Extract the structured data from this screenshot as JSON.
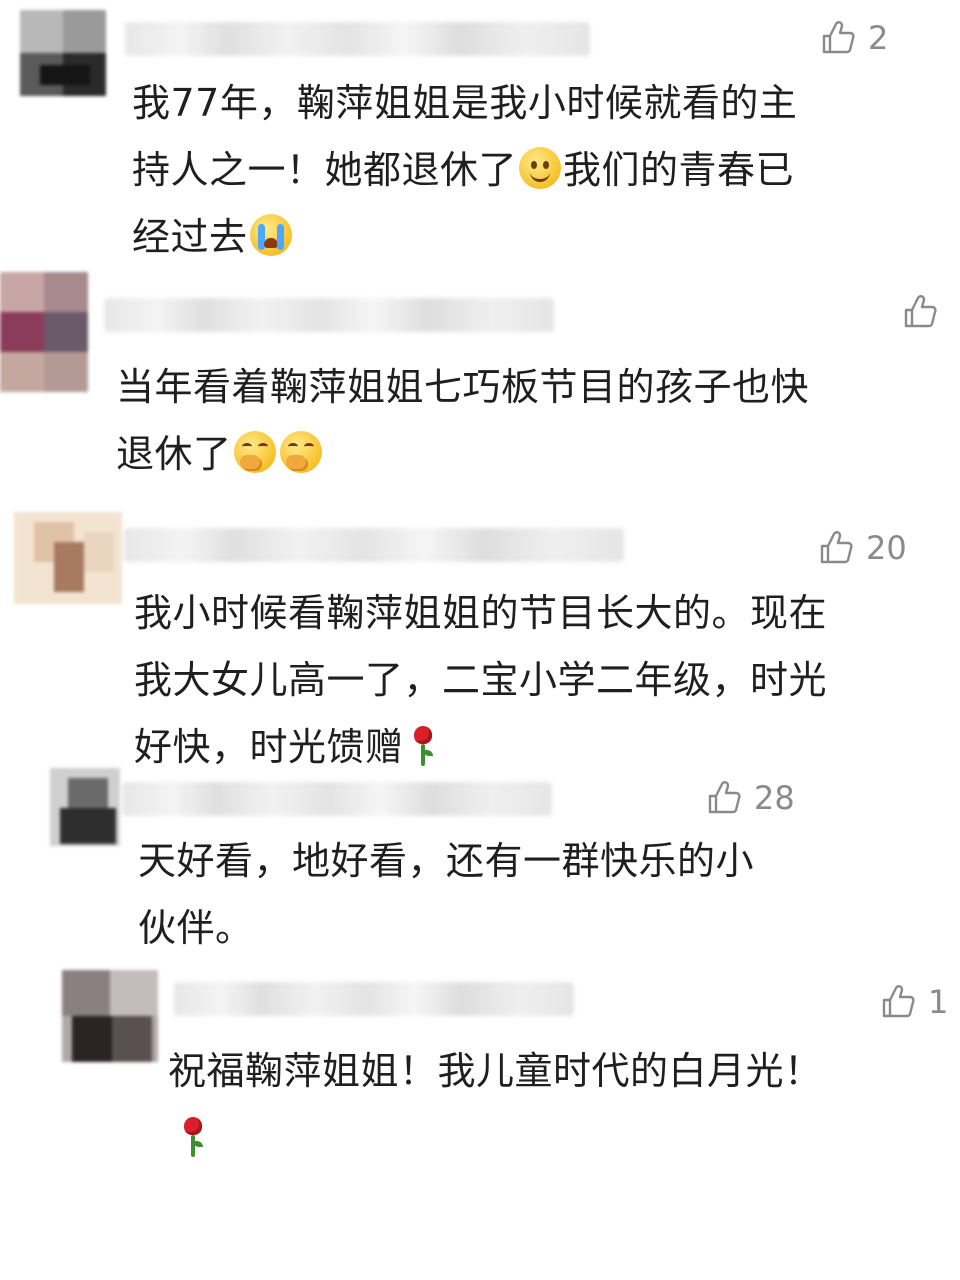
{
  "comments": [
    {
      "likes": "2",
      "text_lines": [
        "我77年，鞠萍姐姐是我小时候就看的主",
        "持人之一！她都退休了",
        "我们的青春已",
        "经过去"
      ]
    },
    {
      "likes": "",
      "text_lines": [
        "当年看着鞠萍姐姐七巧板节目的孩子也快",
        "退休了"
      ]
    },
    {
      "likes": "20",
      "text_lines": [
        "我小时候看鞠萍姐姐的节目长大的。现在",
        "我大女儿高一了，二宝小学二年级，时光",
        "好快，时光馈赠"
      ]
    },
    {
      "likes": "28",
      "text_lines": [
        "天好看，地好看，还有一群快乐的小",
        "伙伴。"
      ]
    },
    {
      "likes": "1",
      "text_lines": [
        "祝福鞠萍姐姐！我儿童时代的白月光！"
      ]
    }
  ],
  "icons": {
    "like": "thumbs-up-icon",
    "emoji_smile": "smile-emoji-icon",
    "emoji_cry": "crying-emoji-icon",
    "emoji_think": "thinking-emoji-icon",
    "rose": "rose-icon"
  },
  "colors": {
    "text": "#1f1f1f",
    "like": "#8a8a8a",
    "background": "#ffffff"
  }
}
